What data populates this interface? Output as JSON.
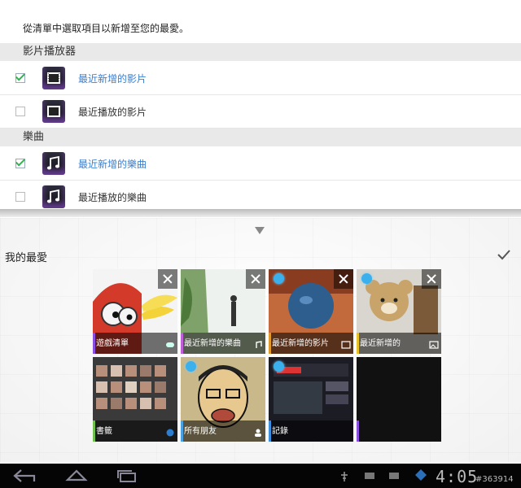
{
  "picker": {
    "hint": "從清單中選取項目以新增至您的最愛。",
    "sections": [
      {
        "title": "影片播放器",
        "items": [
          {
            "label": "最近新增的影片",
            "checked": true
          },
          {
            "label": "最近播放的影片",
            "checked": false
          }
        ]
      },
      {
        "title": "樂曲",
        "items": [
          {
            "label": "最近新增的樂曲",
            "checked": true
          },
          {
            "label": "最近播放的樂曲",
            "checked": false
          }
        ]
      }
    ]
  },
  "favorites": {
    "title": "我的最愛",
    "tiles": [
      {
        "label": "遊戲清單",
        "accent": "#8a4fe0"
      },
      {
        "label": "最近新增的樂曲",
        "accent": "#c060d8"
      },
      {
        "label": "最近新增的影片",
        "accent": "#e39a2c"
      },
      {
        "label": "最近新增的",
        "accent": "#e8c12b"
      },
      {
        "label": "書籤",
        "accent": "#6fc04c"
      },
      {
        "label": "所有朋友",
        "accent": "#4aa0e0"
      },
      {
        "label": "記錄",
        "accent": "#3d8fe0"
      },
      {
        "label": "",
        "accent": "#8a4fe0"
      }
    ]
  },
  "statusbar": {
    "time": "4:05",
    "watermark": "#363914"
  },
  "colors": {
    "accent_blue": "#3a7fd0",
    "check_green": "#35b055"
  }
}
